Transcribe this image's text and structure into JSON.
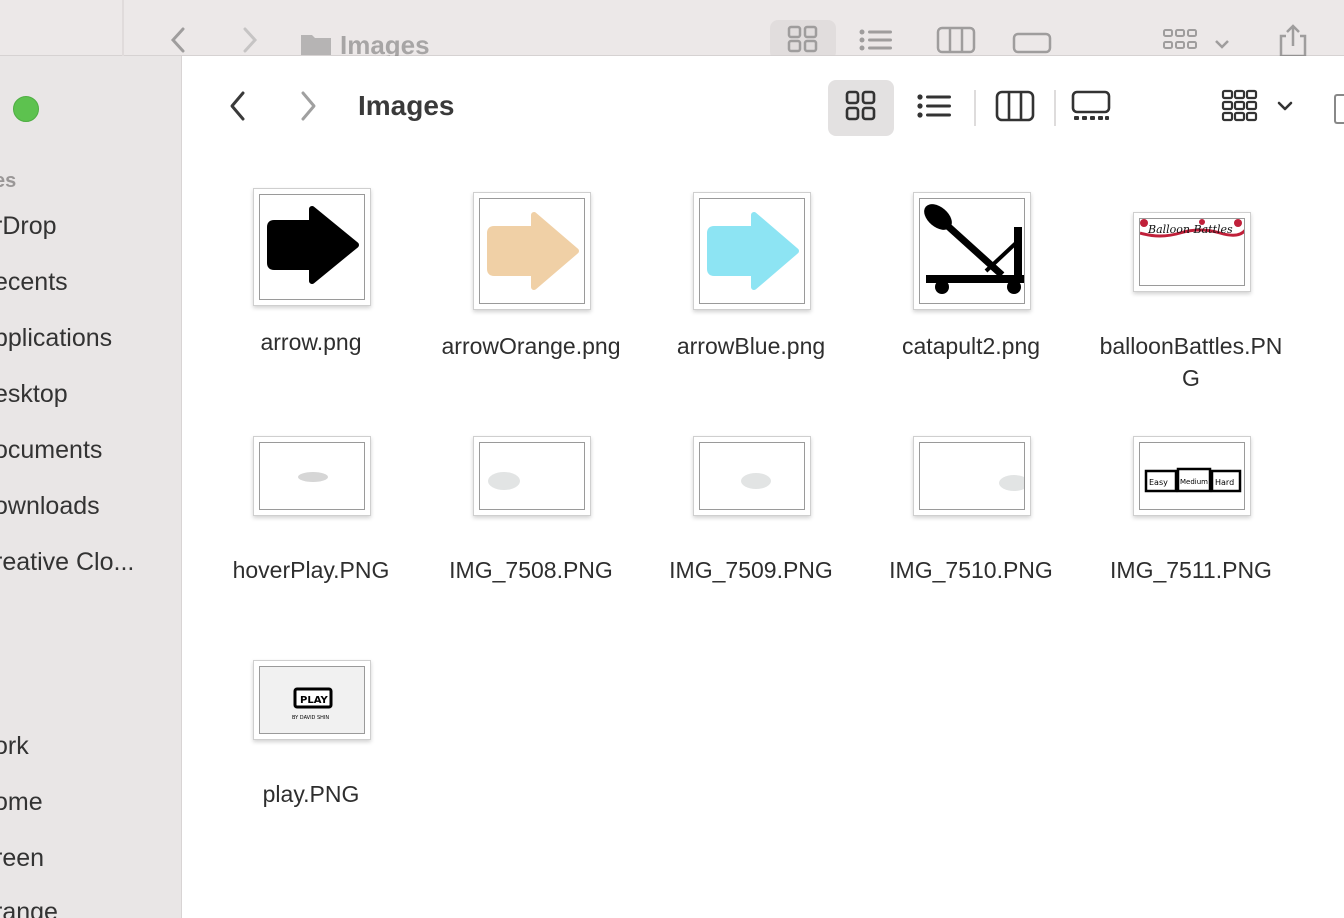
{
  "background_window": {
    "title": "Images"
  },
  "sidebar": {
    "section_header": "es",
    "items": [
      {
        "label": "rDrop"
      },
      {
        "label": "ecents"
      },
      {
        "label": "pplications"
      },
      {
        "label": "esktop"
      },
      {
        "label": "ocuments"
      },
      {
        "label": "ownloads"
      },
      {
        "label": "reative Clo..."
      }
    ],
    "tags": [
      {
        "label": "ork"
      },
      {
        "label": "ome"
      },
      {
        "label": "reen"
      },
      {
        "label": "range"
      }
    ]
  },
  "toolbar": {
    "title": "Images",
    "back_icon": "chevron-left-icon",
    "forward_icon": "chevron-right-icon",
    "views": [
      "icon-view-icon",
      "list-view-icon",
      "column-view-icon",
      "gallery-view-icon"
    ],
    "selected_view": "icon-view-icon",
    "group_icon": "group-grid-icon"
  },
  "files": [
    {
      "name": "arrow.png",
      "thumb": "arrow-black"
    },
    {
      "name": "arrowOrange.png",
      "thumb": "arrow-orange"
    },
    {
      "name": "arrowBlue.png",
      "thumb": "arrow-blue"
    },
    {
      "name": "catapult2.png",
      "thumb": "catapult"
    },
    {
      "name": "balloonBattles.PNG",
      "thumb": "balloon-battles"
    },
    {
      "name": "hoverPlay.PNG",
      "thumb": "hover-play"
    },
    {
      "name": "IMG_7508.PNG",
      "thumb": "cloud-left"
    },
    {
      "name": "IMG_7509.PNG",
      "thumb": "cloud-center"
    },
    {
      "name": "IMG_7510.PNG",
      "thumb": "cloud-right"
    },
    {
      "name": "IMG_7511.PNG",
      "thumb": "easy-medium-hard"
    },
    {
      "name": "play.PNG",
      "thumb": "play"
    }
  ],
  "colors": {
    "arrow_black": "#000000",
    "arrow_orange": "#f0d0a6",
    "arrow_blue": "#8de4f3",
    "traffic_green": "#5dc24f"
  }
}
